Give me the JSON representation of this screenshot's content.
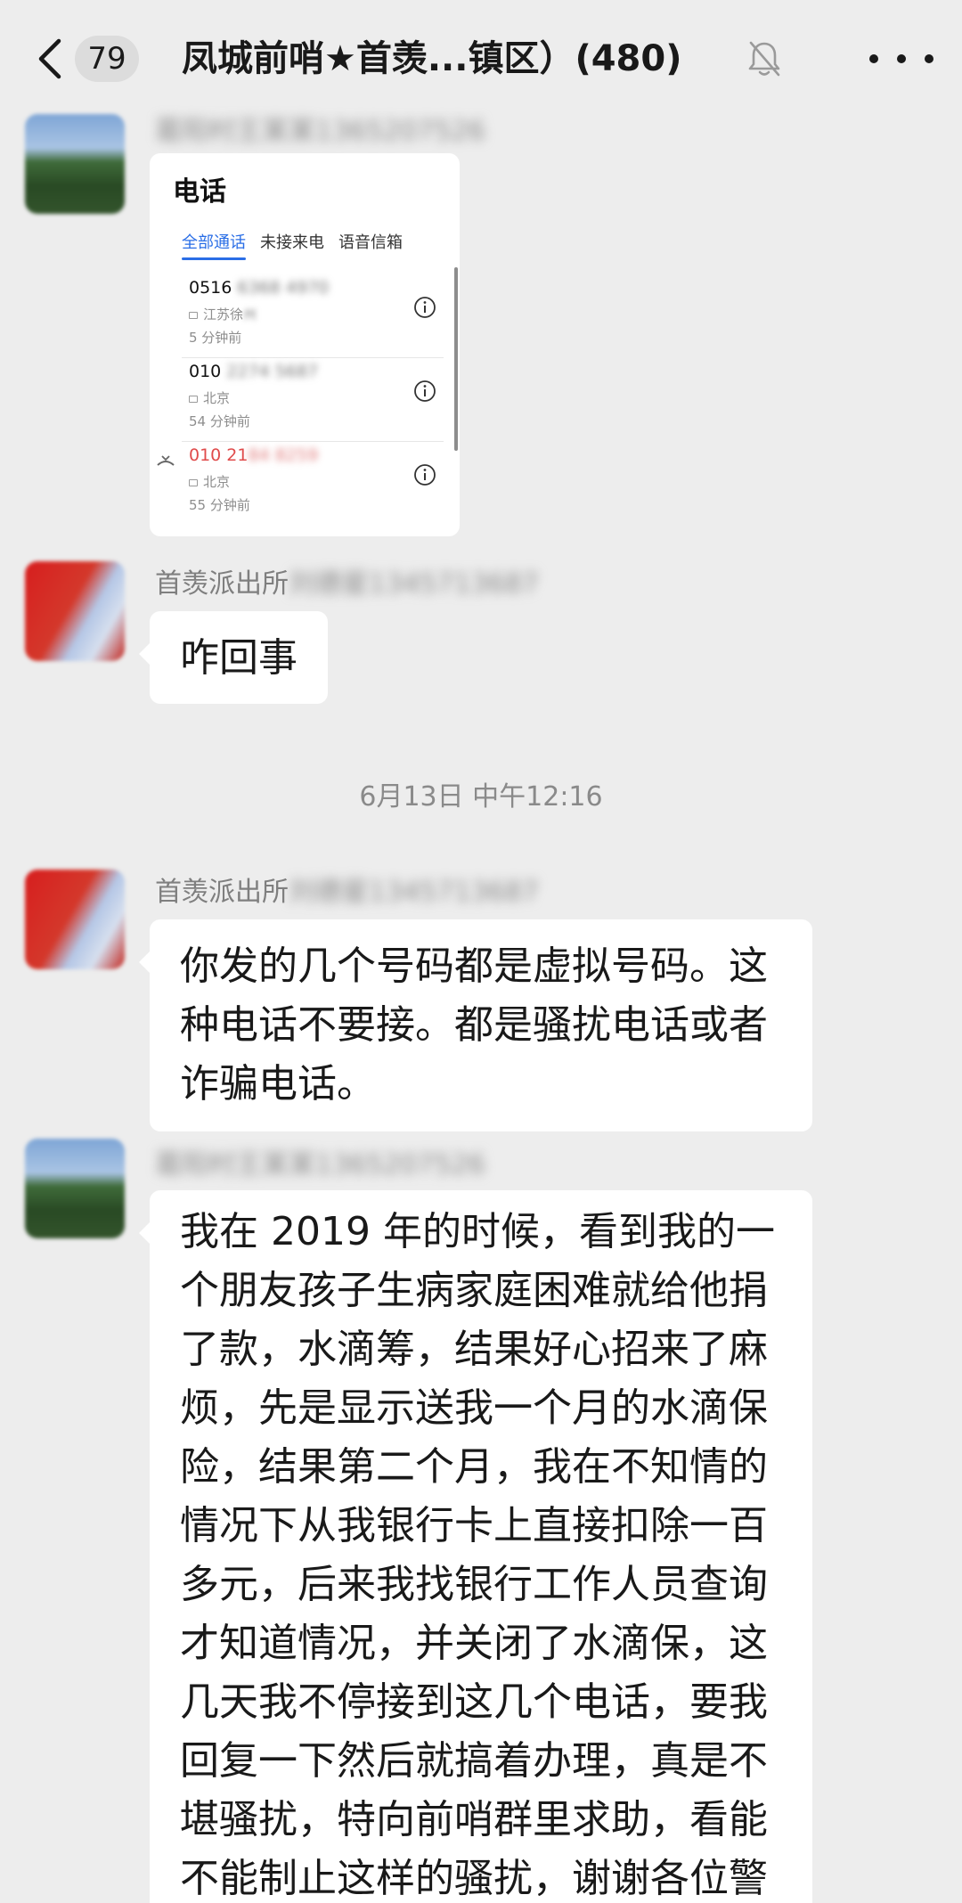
{
  "header": {
    "unread_count": "79",
    "title": "凤城前哨★首羡...镇区）(480)",
    "icons": {
      "back": "chevron-left-icon",
      "mute": "bell-muted-icon",
      "more": "more-dots-icon"
    }
  },
  "messages": [
    {
      "sender": "",
      "type": "image",
      "screenshot": {
        "title": "电话",
        "tabs": [
          "全部通话",
          "未接来电",
          "语音信箱"
        ],
        "calls": [
          {
            "number_visible": "0516",
            "number_hidden": " 6368 4970",
            "location_visible": "江苏徐",
            "location_hidden": "州",
            "time": "5 分钟前",
            "missed": false
          },
          {
            "number_visible": "010",
            "number_hidden": " 2274 5687",
            "location_visible": "北京",
            "location_hidden": "",
            "time": "54 分钟前",
            "missed": false
          },
          {
            "number_visible": "010 21",
            "number_hidden": "84 8259",
            "location_visible": "北京",
            "location_hidden": "",
            "time": "55 分钟前",
            "missed": true
          }
        ]
      }
    },
    {
      "sender_visible": "首羡派出所",
      "sender_hidden": "刘德星1345713687",
      "type": "text",
      "text": "咋回事"
    },
    {
      "type": "timestamp",
      "text": "6月13日 中午12:16"
    },
    {
      "sender_visible": "首羡派出所",
      "sender_hidden": "刘德星1345713687",
      "type": "text",
      "text": "你发的几个号码都是虚拟号码。这种电话不要接。都是骚扰电话或者诈骗电话。"
    },
    {
      "sender": "",
      "type": "text",
      "text": "我在 2019 年的时候，看到我的一个朋友孩子生病家庭困难就给他捐了款，水滴筹，结果好心招来了麻烦，先是显示送我一个月的水滴保险，结果第二个月，我在不知情的情况下从我银行卡上直接扣除一百多元，后来我找银行工作人员查询才知道情况，并关闭了水滴保，这几天我不停接到这几个电话，要我回复一下然后就搞着办理，真是不堪骚扰，特向前哨群里求助，看能不能制止这样的骚扰，谢谢各位警官！！"
    }
  ],
  "blurred_sender_placeholder": "葛阳村王某某1365207526"
}
